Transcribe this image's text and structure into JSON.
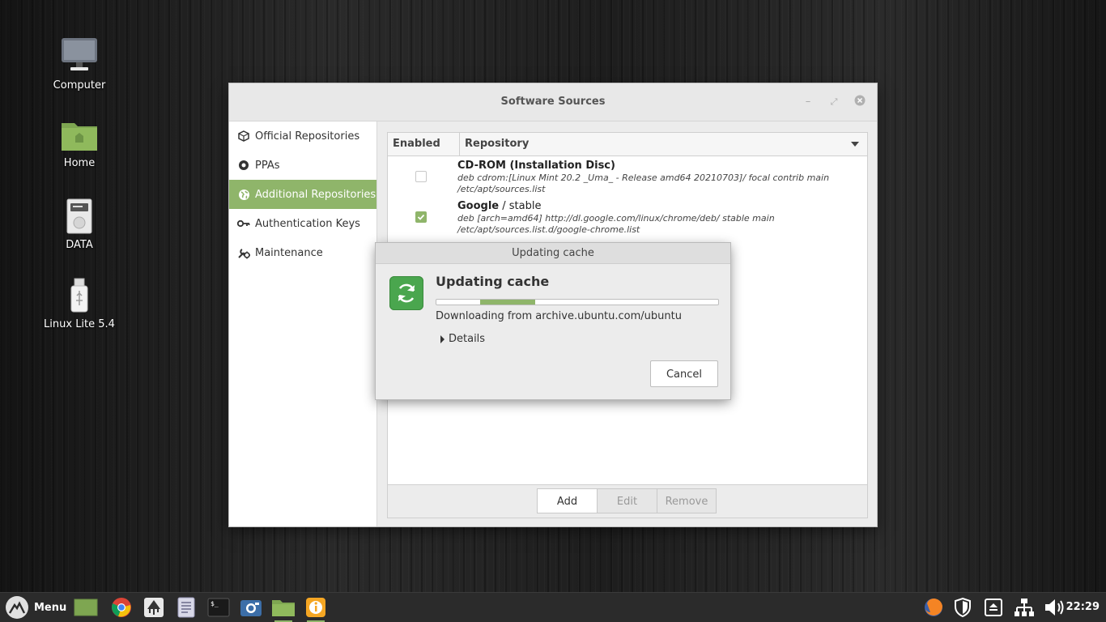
{
  "desktop": {
    "icons": [
      {
        "label": "Computer"
      },
      {
        "label": "Home"
      },
      {
        "label": "DATA"
      },
      {
        "label": "Linux Lite 5.4"
      }
    ]
  },
  "window": {
    "title": "Software Sources",
    "sidebar": [
      {
        "label": "Official Repositories",
        "icon": "package-icon"
      },
      {
        "label": "PPAs",
        "icon": "ppa-icon"
      },
      {
        "label": "Additional Repositories",
        "icon": "globe-icon",
        "active": true
      },
      {
        "label": "Authentication Keys",
        "icon": "key-icon"
      },
      {
        "label": "Maintenance",
        "icon": "maintenance-icon"
      }
    ],
    "table": {
      "col_enabled": "Enabled",
      "col_repository": "Repository",
      "rows": [
        {
          "enabled": false,
          "name": "CD-ROM (Installation Disc)",
          "suffix": "",
          "line1": "deb cdrom:[Linux Mint 20.2 _Uma_ - Release amd64 20210703]/ focal contrib main",
          "line2": "/etc/apt/sources.list"
        },
        {
          "enabled": true,
          "name": "Google",
          "suffix": " / stable",
          "line1": "deb [arch=amd64] http://dl.google.com/linux/chrome/deb/ stable main",
          "line2": "/etc/apt/sources.list.d/google-chrome.list"
        }
      ]
    },
    "buttons": {
      "add": "Add",
      "edit": "Edit",
      "remove": "Remove"
    }
  },
  "dialog": {
    "title": "Updating cache",
    "heading": "Updating cache",
    "progress": 0.19,
    "status": "Downloading from archive.ubuntu.com/ubuntu",
    "details": "Details",
    "cancel": "Cancel"
  },
  "taskbar": {
    "menu_label": "Menu",
    "clock": "22:29"
  },
  "colors": {
    "accent": "#8fb56a",
    "panel": "#2b2b2b"
  }
}
